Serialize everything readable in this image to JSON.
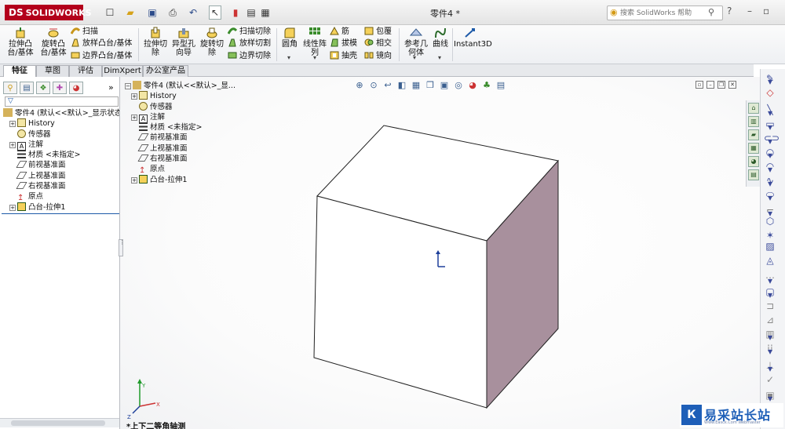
{
  "app": {
    "logo": "SOLIDWORKS",
    "document_title": "零件4 *",
    "search_placeholder": "搜索 SolidWorks 帮助"
  },
  "ribbon": {
    "big_buttons": [
      {
        "label": "拉伸凸\n台/基体"
      },
      {
        "label": "旋转凸\n台/基体"
      },
      {
        "label": "拉伸切\n除"
      },
      {
        "label": "异型孔\n向导"
      },
      {
        "label": "旋转切\n除"
      },
      {
        "label": "圆角"
      },
      {
        "label": "线性阵\n列"
      },
      {
        "label": "参考几\n何体"
      },
      {
        "label": "曲线"
      },
      {
        "label": "Instant3D"
      }
    ],
    "small_buttons": [
      {
        "label": "扫描"
      },
      {
        "label": "放样凸台/基体"
      },
      {
        "label": "边界凸台/基体"
      },
      {
        "label": "扫描切除"
      },
      {
        "label": "放样切割"
      },
      {
        "label": "边界切除"
      },
      {
        "label": "筋"
      },
      {
        "label": "拔模"
      },
      {
        "label": "抽壳"
      },
      {
        "label": "包覆"
      },
      {
        "label": "相交"
      },
      {
        "label": "镜向"
      }
    ]
  },
  "tabs": [
    {
      "label": "特征",
      "active": true
    },
    {
      "label": "草图",
      "active": false
    },
    {
      "label": "评估",
      "active": false
    },
    {
      "label": "DimXpert",
      "active": false
    },
    {
      "label": "办公室产品",
      "active": false
    }
  ],
  "feature_tree": {
    "root": "零件4 (默认<<默认>_显示状态",
    "items": [
      {
        "label": "History",
        "icon": "history-icon"
      },
      {
        "label": "传感器",
        "icon": "sensor-icon"
      },
      {
        "label": "注解",
        "icon": "annotation-icon"
      },
      {
        "label": "材质 <未指定>",
        "icon": "material-icon"
      },
      {
        "label": "前视基准面",
        "icon": "plane-icon"
      },
      {
        "label": "上视基准面",
        "icon": "plane-icon"
      },
      {
        "label": "右视基准面",
        "icon": "plane-icon"
      },
      {
        "label": "原点",
        "icon": "origin-icon"
      },
      {
        "label": "凸台-拉伸1",
        "icon": "extrude-icon"
      }
    ]
  },
  "graphics_tree": {
    "root": "零件4 (默认<<默认>_显...",
    "items": [
      {
        "label": "History"
      },
      {
        "label": "传感器"
      },
      {
        "label": "注解"
      },
      {
        "label": "材质 <未指定>"
      },
      {
        "label": "前视基准面"
      },
      {
        "label": "上视基准面"
      },
      {
        "label": "右视基准面"
      },
      {
        "label": "原点"
      },
      {
        "label": "凸台-拉伸1"
      }
    ]
  },
  "view": {
    "label": "*上下二等角轴测"
  },
  "watermark": {
    "text": "易采站长站",
    "sub": "Www.Easck.Com Webmaster"
  },
  "colors": {
    "accent": "#1d5aa8",
    "cube_top": "#ffffff",
    "cube_front": "#ffffff",
    "cube_side": "#a8909d"
  }
}
